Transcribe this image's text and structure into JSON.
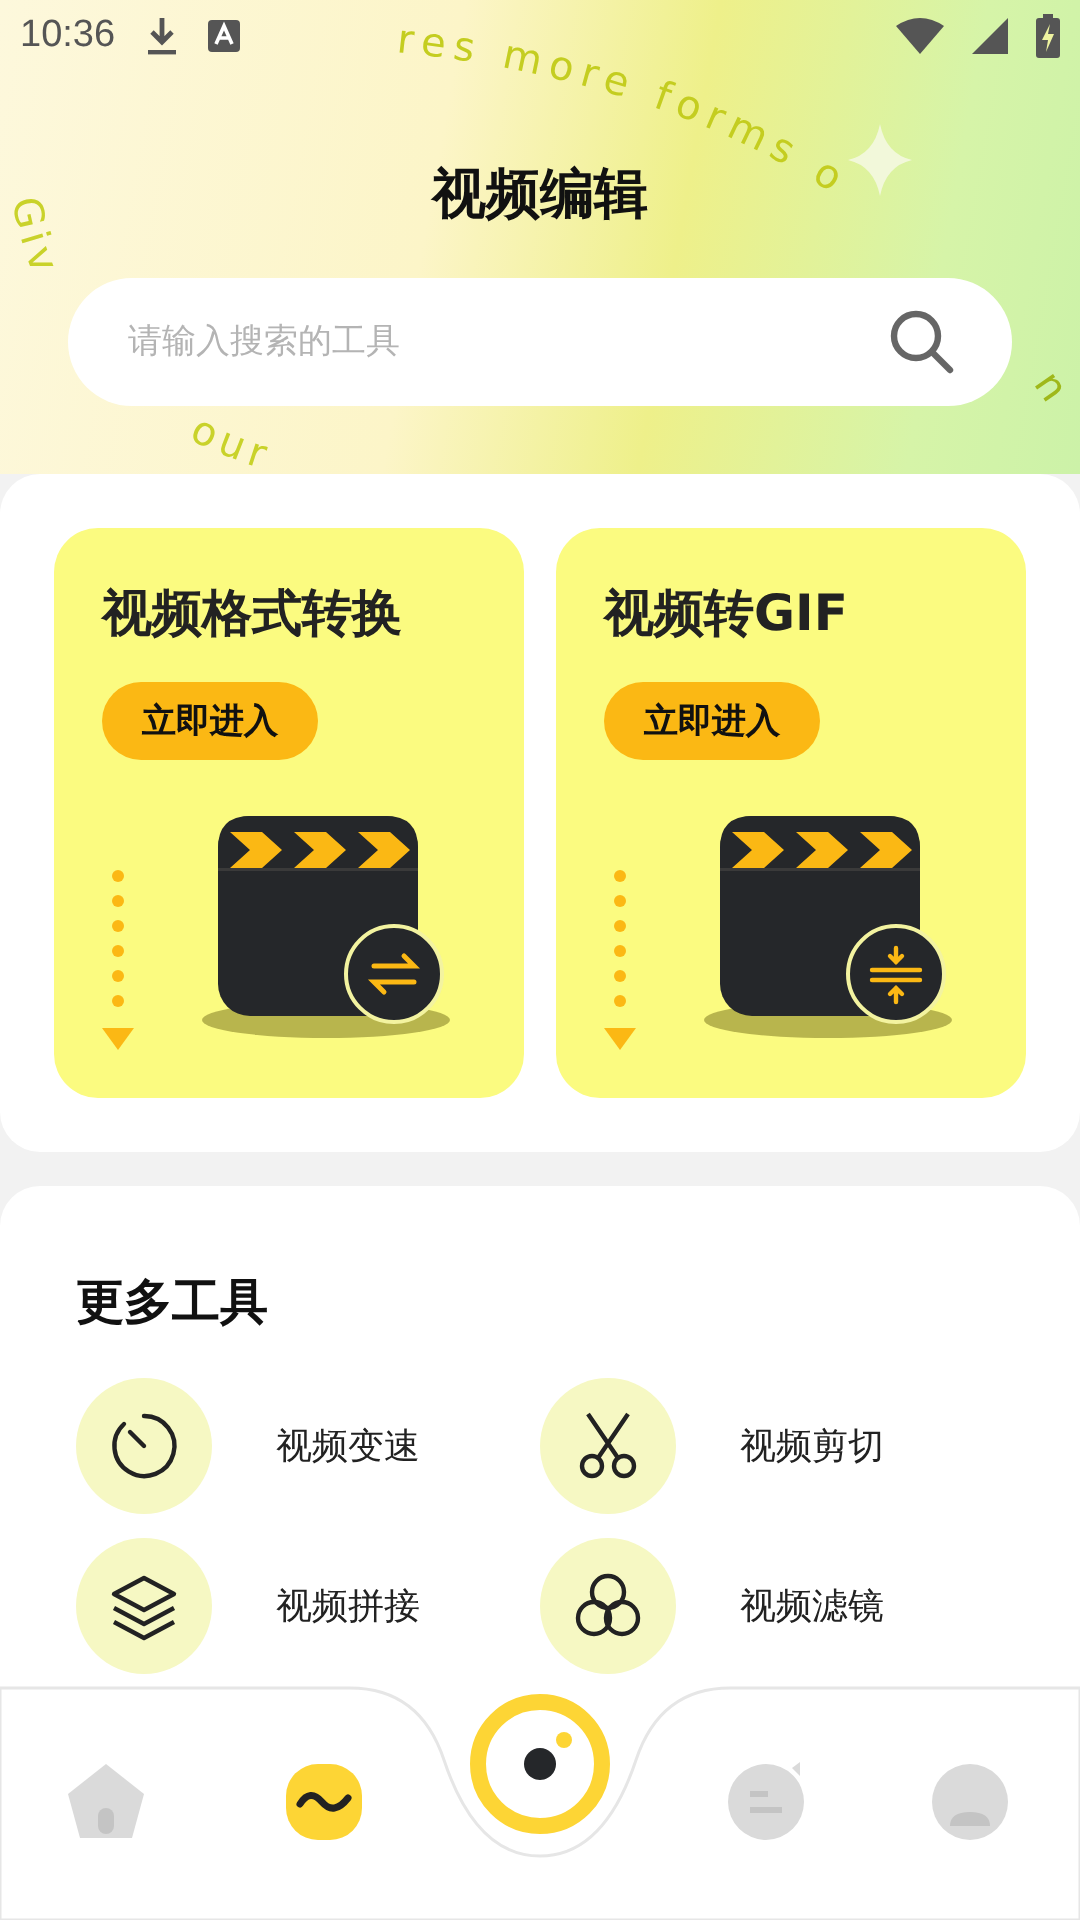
{
  "status_bar": {
    "time": "10:36"
  },
  "header": {
    "title": "视频编辑",
    "decor_texts": [
      "Giv",
      "our",
      "res more forms o",
      "n"
    ],
    "search": {
      "placeholder": "请输入搜索的工具"
    }
  },
  "feature_cards": [
    {
      "title": "视频格式转换",
      "button": "立即进入",
      "kind": "convert"
    },
    {
      "title": "视频转GIF",
      "button": "立即进入",
      "kind": "compress"
    }
  ],
  "more_tools": {
    "title": "更多工具",
    "items": [
      {
        "label": "视频变速",
        "kind": "speed"
      },
      {
        "label": "视频剪切",
        "kind": "cut"
      },
      {
        "label": "视频拼接",
        "kind": "merge"
      },
      {
        "label": "视频滤镜",
        "kind": "filter"
      }
    ]
  },
  "bottom_nav": [
    {
      "kind": "home",
      "selected": false
    },
    {
      "kind": "edit",
      "selected": true
    },
    {
      "kind": "camera",
      "selected": false
    },
    {
      "kind": "chat",
      "selected": false
    },
    {
      "kind": "profile",
      "selected": false
    }
  ]
}
